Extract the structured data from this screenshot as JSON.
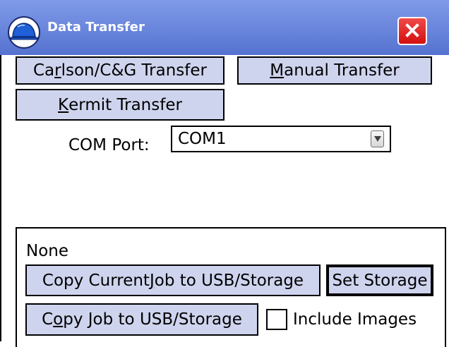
{
  "window": {
    "title": "Data Transfer",
    "icons": {
      "app": "hard-hat-icon",
      "close": "close-icon"
    },
    "colors": {
      "titlebar": "#6d89de",
      "close_button": "#e02020",
      "button_face": "#cfd4ee"
    }
  },
  "buttons": {
    "carlson": {
      "pre": "Ca",
      "u": "r",
      "post": "lson/C&G Transfer"
    },
    "manual": {
      "pre": "",
      "u": "M",
      "post": "anual Transfer"
    },
    "kermit": {
      "pre": "",
      "u": "K",
      "post": "ermit Transfer"
    }
  },
  "com_port": {
    "label": "COM Port:",
    "value": "COM1",
    "icon": "dropdown-arrow-icon"
  },
  "storage": {
    "location": "None",
    "copy_current": {
      "pre": "Copy Current ",
      "u": "J",
      "post": "ob to USB/Storage"
    },
    "set_storage": "Set Storage",
    "copy_job": {
      "pre": "C",
      "u": "o",
      "post": "py Job to USB/Storage"
    },
    "include_images": {
      "label": "Include Images",
      "checked": false
    }
  }
}
